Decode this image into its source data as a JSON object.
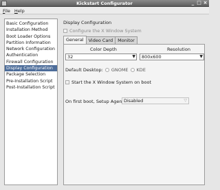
{
  "window": {
    "title": "Kickstart Configurator",
    "min_glyph": "_",
    "max_glyph": "□",
    "close_glyph": "×"
  },
  "menu": [
    {
      "mnemonic": "F",
      "rest": "ile"
    },
    {
      "mnemonic": "H",
      "rest": "elp"
    }
  ],
  "sidebar": {
    "items": [
      "Basic Configuration",
      "Installation Method",
      "Boot Loader Options",
      "Partition Information",
      "Network Configuration",
      "Authentication",
      "Firewall Configuration",
      "Display Configuration",
      "Package Selection",
      "Pre-Installation Script",
      "Post-Installation Script"
    ],
    "selected_index": 7
  },
  "main": {
    "group_title": "Display Configuration",
    "configure_x_label": "Configure the X Window System",
    "tabs": [
      "General",
      "Video Card",
      "Monitor"
    ],
    "active_tab": 0,
    "color_depth_header": "Color Depth",
    "resolution_header": "Resolution",
    "color_depth_value": "32",
    "resolution_value": "800x600",
    "default_desktop_label": "Default Desktop:",
    "desktop_options": [
      "GNOME",
      "KDE"
    ],
    "start_x_label": "Start the X Window System on boot",
    "first_boot_label": "On first boot, Setup Agent is:",
    "first_boot_value": "Disabled"
  },
  "icons": {
    "combo_arrow": "▼",
    "disabled_arrow": "▽"
  }
}
